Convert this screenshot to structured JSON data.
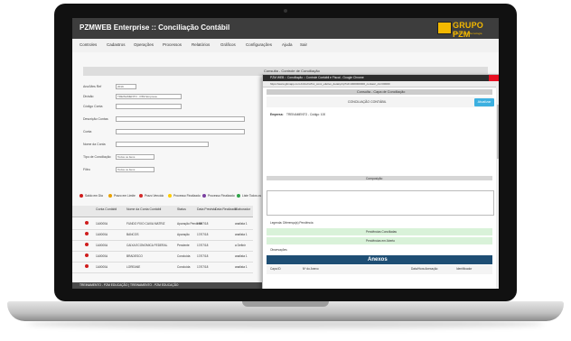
{
  "app": {
    "title": "PZMWEB Enterprise :: Conciliação Contábil"
  },
  "brand": {
    "name": "GRUPO PZM",
    "tagline": "Soluções em Tecnologia",
    "color": "#f3b800"
  },
  "menu": [
    "Controles",
    "Cadastros",
    "Operações",
    "Processos",
    "Relatórios",
    "Gráficos",
    "Configurações",
    "Ajuda",
    "Sair"
  ],
  "main": {
    "banner": "Consulta - Controle de Conciliação",
    "fields": [
      {
        "label": "Ano/Mes Ref",
        "value": "2019"
      },
      {
        "label": "Divisão",
        "value": "TREINAMENTO - PZM Empresa"
      },
      {
        "label": "Código Conta",
        "value": ""
      },
      {
        "label": "Descrição Contas",
        "value": ""
      },
      {
        "label": "Conta",
        "value": ""
      },
      {
        "label": "Nome da Conta",
        "value": ""
      },
      {
        "label": "Tipo de Conciliação",
        "value": "Todos os Itens"
      },
      {
        "label": "Filtro",
        "value": "Todos os Itens"
      }
    ],
    "legend": [
      "Saldo em Dia",
      "Prazo em Limite",
      "Prazo Vencido",
      "Processo Finalizado",
      "Processo Finalizado",
      "Liste Todos os Status"
    ],
    "columns": [
      "Conta Contábil",
      "Nome da Conta Contábil",
      "Status",
      "Data Prevista",
      "Data Realizada",
      "Elaborador"
    ],
    "rows": [
      {
        "code": "1A0000A",
        "name": "FUNDO FIXO CAIXA MATRIZ",
        "status": "Apuração Pendente",
        "prev": "17/07/18",
        "user": "analista 1"
      },
      {
        "code": "1A0000A",
        "name": "BANCOS",
        "status": "Apuração",
        "prev": "17/07/18",
        "user": "analista 1"
      },
      {
        "code": "1A0000A",
        "name": "CAIXA ECONOMICA FEDERAL",
        "status": "Pendente",
        "prev": "17/07/18",
        "user": "a Definir"
      },
      {
        "code": "1A0000A",
        "name": "BRADESCO",
        "status": "Concluída",
        "prev": "17/07/18",
        "user": "analista 1"
      },
      {
        "code": "1A0000A",
        "name": "LOREANE",
        "status": "Concluída",
        "prev": "17/07/18",
        "user": "analista 1"
      }
    ],
    "footer": "TREINAMENTO - PZM EDUCAÇÃO | TREINAMENTO - PZM EDUCAÇÃO"
  },
  "popup": {
    "window_title": "PZM WEB :: Conciliação :: Controle Contábil e Fiscal - Google Chrome",
    "url": "https://www.gitmapp.com.br/cc/cc/fnc_conc_efetivo_detail.php?id=1000000000_contacc_ctc=00000",
    "banner": "Consulta - Capa de Conciliação",
    "subtitle": "CONCILIAÇÃO CONTÁBIL",
    "save_label": "Atualizar",
    "empresa_label": "Empresa:",
    "empresa_value": "TREINAMENTO - Código: 100",
    "section_composition": "Composição",
    "legend_label": "Legenda: Diferença(s) Pendência",
    "pending_1": "Pendências Conciliadas",
    "pending_2": "Pendências em Aberto",
    "observations": "Observações",
    "annex_title": "Anexos",
    "annex_cols": [
      "Capa ID",
      "Nº do Anexo",
      "Data/Hora Anexação",
      "Identificador"
    ]
  }
}
